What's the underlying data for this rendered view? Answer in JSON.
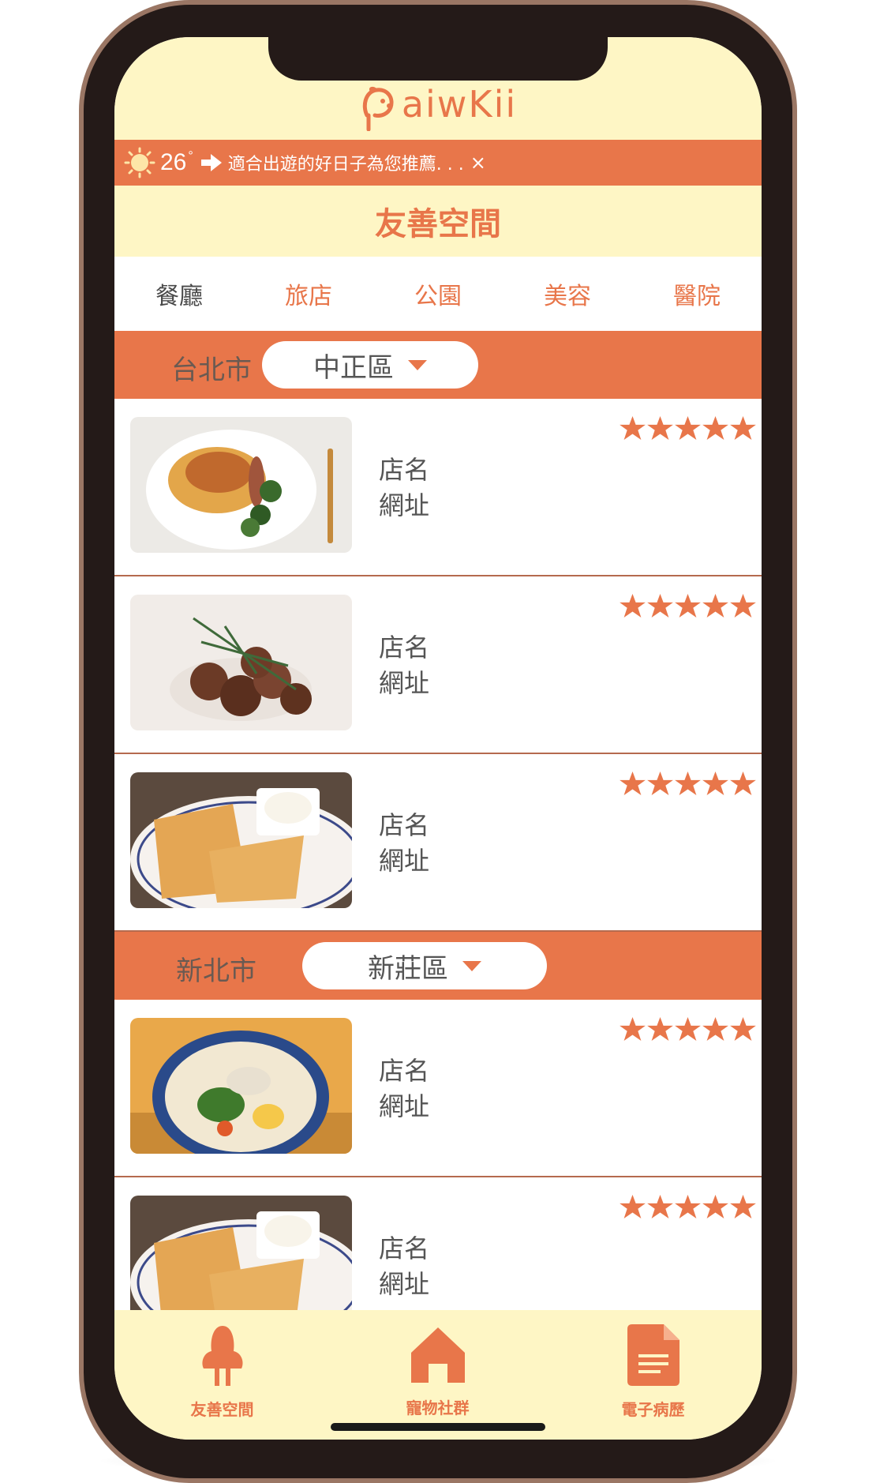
{
  "app": {
    "logo_text": "aiwKii"
  },
  "weather": {
    "temperature": "26",
    "degree": "°",
    "message": "適合出遊的好日子為您推薦. . .",
    "close_symbol": "×"
  },
  "page": {
    "title": "友善空間"
  },
  "tabs": [
    {
      "label": "餐廳",
      "active": true
    },
    {
      "label": "旅店",
      "active": false
    },
    {
      "label": "公園",
      "active": false
    },
    {
      "label": "美容",
      "active": false
    },
    {
      "label": "醫院",
      "active": false
    }
  ],
  "sections": [
    {
      "city": "台北市",
      "district": "中正區",
      "items": [
        {
          "name": "店名",
          "address": "網址",
          "rating": 5,
          "image": "spaghetti-plate"
        },
        {
          "name": "店名",
          "address": "網址",
          "rating": 5,
          "image": "fried-pork-rosemary"
        },
        {
          "name": "店名",
          "address": "網址",
          "rating": 5,
          "image": "waffle-plate"
        }
      ]
    },
    {
      "city": "新北市",
      "district": "新莊區",
      "items": [
        {
          "name": "店名",
          "address": "網址",
          "rating": 5,
          "image": "noodle-soup-bowl"
        },
        {
          "name": "店名",
          "address": "網址",
          "rating": 5,
          "image": "waffle-plate"
        }
      ]
    }
  ],
  "bottom_nav": [
    {
      "label": "友善空間",
      "icon": "tree-icon"
    },
    {
      "label": "寵物社群",
      "icon": "home-icon"
    },
    {
      "label": "電子病歷",
      "icon": "document-icon"
    }
  ],
  "colors": {
    "accent": "#e8764a",
    "header_bg": "#fef6c5",
    "frame": "#241a18"
  }
}
